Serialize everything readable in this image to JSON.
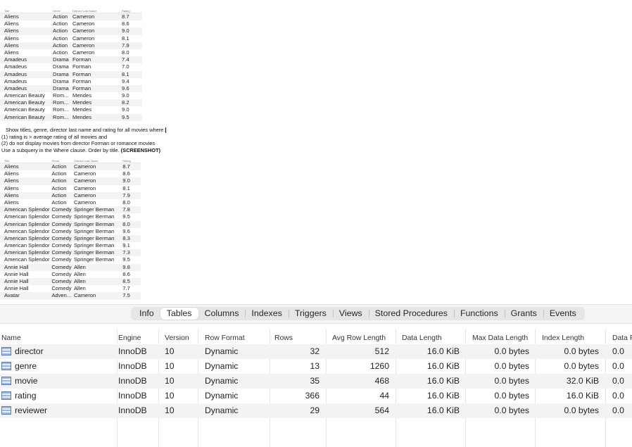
{
  "screenshot1": {
    "headers": [
      "Title",
      "Genre",
      "Director Last Name",
      "Rating"
    ],
    "rows": [
      [
        "Aliens",
        "Action",
        "Cameron",
        "8.7"
      ],
      [
        "Aliens",
        "Action",
        "Cameron",
        "8.6"
      ],
      [
        "Aliens",
        "Action",
        "Cameron",
        "9.0"
      ],
      [
        "Aliens",
        "Action",
        "Cameron",
        "8.1"
      ],
      [
        "Aliens",
        "Action",
        "Cameron",
        "7.9"
      ],
      [
        "Aliens",
        "Action",
        "Cameron",
        "8.0"
      ],
      [
        "Amadeus",
        "Drama",
        "Forman",
        "7.4"
      ],
      [
        "Amadeus",
        "Drama",
        "Forman",
        "7.0"
      ],
      [
        "Amadeus",
        "Drama",
        "Forman",
        "8.1"
      ],
      [
        "Amadeus",
        "Drama",
        "Forman",
        "9.4"
      ],
      [
        "Amadeus",
        "Drama",
        "Forman",
        "9.6"
      ],
      [
        "American Beauty",
        "Rom...",
        "Mendes",
        "9.0"
      ],
      [
        "American Beauty",
        "Rom...",
        "Mendes",
        "8.2"
      ],
      [
        "American Beauty",
        "Rom...",
        "Mendes",
        "9.0"
      ],
      [
        "American Beauty",
        "Rom...",
        "Mendes",
        "9.5"
      ]
    ]
  },
  "instructions": {
    "line1": "Show titles, genre, director last name and rating for all movies where:",
    "line2": "(1) rating is > average rating of all movies and",
    "line3": "(2) do not display movies from director Forman or romance movies",
    "line4": "Use a subquery in the Where clause. Order by title.",
    "line4_bold": "(SCREENSHOT)"
  },
  "screenshot2": {
    "headers": [
      "Title",
      "Genre",
      "Director Last Name",
      "Rating"
    ],
    "rows": [
      [
        "Aliens",
        "Action",
        "Cameron",
        "8.7"
      ],
      [
        "Aliens",
        "Action",
        "Cameron",
        "8.6"
      ],
      [
        "Aliens",
        "Action",
        "Cameron",
        "9.0"
      ],
      [
        "Aliens",
        "Action",
        "Cameron",
        "8.1"
      ],
      [
        "Aliens",
        "Action",
        "Cameron",
        "7.9"
      ],
      [
        "Aliens",
        "Action",
        "Cameron",
        "8.0"
      ],
      [
        "American Splendor",
        "Comedy",
        "Springer Berman",
        "7.8"
      ],
      [
        "American Splendor",
        "Comedy",
        "Springer Berman",
        "9.5"
      ],
      [
        "American Splendor",
        "Comedy",
        "Springer Berman",
        "8.0"
      ],
      [
        "American Splendor",
        "Comedy",
        "Springer Berman",
        "9.6"
      ],
      [
        "American Splendor",
        "Comedy",
        "Springer Berman",
        "8.3"
      ],
      [
        "American Splendor",
        "Comedy",
        "Springer Berman",
        "9.1"
      ],
      [
        "American Splendor",
        "Comedy",
        "Springer Berman",
        "7.3"
      ],
      [
        "American Splendor",
        "Comedy",
        "Springer Berman",
        "9.5"
      ],
      [
        "Annie Hall",
        "Comedy",
        "Allen",
        "9.8"
      ],
      [
        "Annie Hall",
        "Comedy",
        "Allen",
        "8.6"
      ],
      [
        "Annie Hall",
        "Comedy",
        "Allen",
        "8.5"
      ],
      [
        "Annie Hall",
        "Comedy",
        "Allen",
        "7.7"
      ],
      [
        "Avatar",
        "Adven...",
        "Cameron",
        "7.5"
      ]
    ]
  },
  "tabs": [
    "Info",
    "Tables",
    "Columns",
    "Indexes",
    "Triggers",
    "Views",
    "Stored Procedures",
    "Functions",
    "Grants",
    "Events"
  ],
  "active_tab": "Tables",
  "table_headers": [
    "Name",
    "Engine",
    "Version",
    "Row Format",
    "Rows",
    "Avg Row Length",
    "Data Length",
    "Max Data Length",
    "Index Length",
    "Data F"
  ],
  "tables": [
    {
      "name": "director",
      "engine": "InnoDB",
      "version": "10",
      "row_format": "Dynamic",
      "rows": "32",
      "avg_row_length": "512",
      "data_length": "16.0 KiB",
      "max_data_length": "0.0 bytes",
      "index_length": "0.0 bytes",
      "data_free": "0.0"
    },
    {
      "name": "genre",
      "engine": "InnoDB",
      "version": "10",
      "row_format": "Dynamic",
      "rows": "13",
      "avg_row_length": "1260",
      "data_length": "16.0 KiB",
      "max_data_length": "0.0 bytes",
      "index_length": "0.0 bytes",
      "data_free": "0.0"
    },
    {
      "name": "movie",
      "engine": "InnoDB",
      "version": "10",
      "row_format": "Dynamic",
      "rows": "35",
      "avg_row_length": "468",
      "data_length": "16.0 KiB",
      "max_data_length": "0.0 bytes",
      "index_length": "32.0 KiB",
      "data_free": "0.0"
    },
    {
      "name": "rating",
      "engine": "InnoDB",
      "version": "10",
      "row_format": "Dynamic",
      "rows": "366",
      "avg_row_length": "44",
      "data_length": "16.0 KiB",
      "max_data_length": "0.0 bytes",
      "index_length": "16.0 KiB",
      "data_free": "0.0"
    },
    {
      "name": "reviewer",
      "engine": "InnoDB",
      "version": "10",
      "row_format": "Dynamic",
      "rows": "29",
      "avg_row_length": "564",
      "data_length": "16.0 KiB",
      "max_data_length": "0.0 bytes",
      "index_length": "0.0 bytes",
      "data_free": "0.0"
    }
  ]
}
